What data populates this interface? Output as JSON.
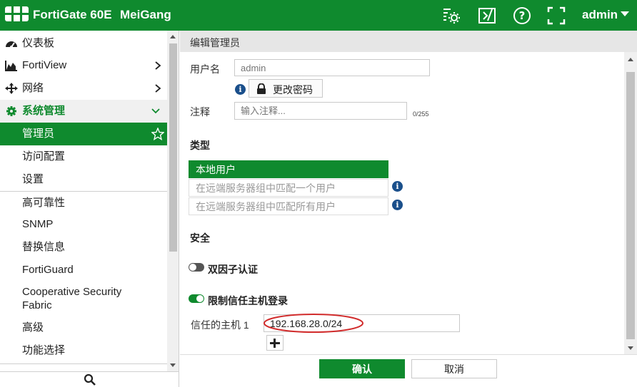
{
  "topbar": {
    "product": "FortiGate 60E",
    "hostname": "MeiGang",
    "user": "admin"
  },
  "sidebar": {
    "items": [
      {
        "label": "仪表板",
        "icon": "dashboard-icon"
      },
      {
        "label": "FortiView",
        "icon": "area-chart-icon"
      },
      {
        "label": "网络",
        "icon": "move-arrows-icon"
      },
      {
        "label": "系统管理",
        "icon": "gear-icon"
      },
      {
        "label": "管理员"
      },
      {
        "label": "访问配置"
      },
      {
        "label": "设置"
      },
      {
        "label": "高可靠性"
      },
      {
        "label": "SNMP"
      },
      {
        "label": "替换信息"
      },
      {
        "label": "FortiGuard"
      },
      {
        "label": "Cooperative Security"
      },
      {
        "label": "Fabric"
      },
      {
        "label": "高级"
      },
      {
        "label": "功能选择"
      }
    ]
  },
  "form": {
    "title": "编辑管理员",
    "username_label": "用户名",
    "username_placeholder": "admin",
    "change_password": "更改密码",
    "comment_label": "注释",
    "comment_placeholder": "输入注释...",
    "comment_counter": "0/255",
    "type_heading": "类型",
    "type_options": [
      "本地用户",
      "在远端服务器组中匹配一个用户",
      "在远端服务器组中匹配所有用户"
    ],
    "security_heading": "安全",
    "two_factor_label": "双因子认证",
    "trusted_hosts_label": "限制信任主机登录",
    "trusted_host1_label": "信任的主机 1",
    "trusted_host1_value": "192.168.28.0/24",
    "ok_button": "确认",
    "cancel_button": "取消"
  },
  "colors": {
    "brand_green": "#0f8a2e",
    "info_blue": "#1a4f8b",
    "annotation_red": "#d12b2b"
  }
}
